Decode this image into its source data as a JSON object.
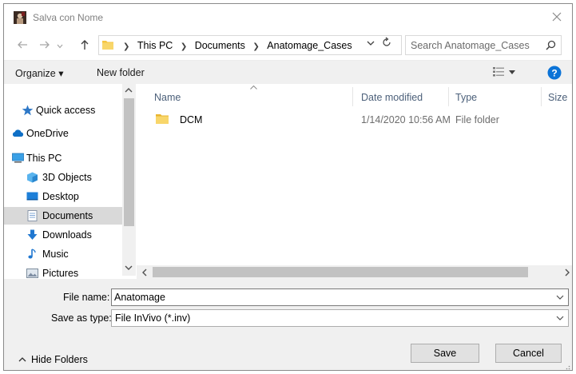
{
  "window": {
    "title": "Salva con Nome",
    "close_icon": "close-icon"
  },
  "address": {
    "crumbs": [
      "This PC",
      "Documents",
      "Anatomage_Cases"
    ],
    "search_placeholder": "Search Anatomage_Cases"
  },
  "toolbar": {
    "organize_label": "Organize ▾",
    "new_folder_label": "New folder",
    "help_icon": "help-icon",
    "view_icon": "view-options-icon"
  },
  "sidebar": {
    "items": [
      {
        "label": "Quick access",
        "icon": "star-icon"
      },
      {
        "label": "OneDrive",
        "icon": "cloud-icon"
      },
      {
        "label": "This PC",
        "icon": "computer-icon"
      },
      {
        "label": "3D Objects",
        "icon": "cube-icon"
      },
      {
        "label": "Desktop",
        "icon": "desktop-icon"
      },
      {
        "label": "Documents",
        "icon": "document-icon"
      },
      {
        "label": "Downloads",
        "icon": "download-icon"
      },
      {
        "label": "Music",
        "icon": "music-icon"
      },
      {
        "label": "Pictures",
        "icon": "pictures-icon"
      }
    ],
    "selected": "Documents"
  },
  "file_list": {
    "columns": [
      "Name",
      "Date modified",
      "Type",
      "Size"
    ],
    "rows": [
      {
        "name": "DCM",
        "date": "1/14/2020 10:56 AM",
        "type": "File folder",
        "size": ""
      }
    ]
  },
  "form": {
    "file_name_label": "File name:",
    "file_name_value": "Anatomage",
    "save_type_label": "Save as type:",
    "save_type_value": "File InVivo (*.inv)"
  },
  "footer": {
    "hide_folders_label": "Hide Folders",
    "save_label": "Save",
    "cancel_label": "Cancel"
  },
  "colors": {
    "folder": "#f5c542",
    "accent_blue": "#0b73d7",
    "selected_bg": "#d9d9d9",
    "header_text": "#4c607a"
  }
}
